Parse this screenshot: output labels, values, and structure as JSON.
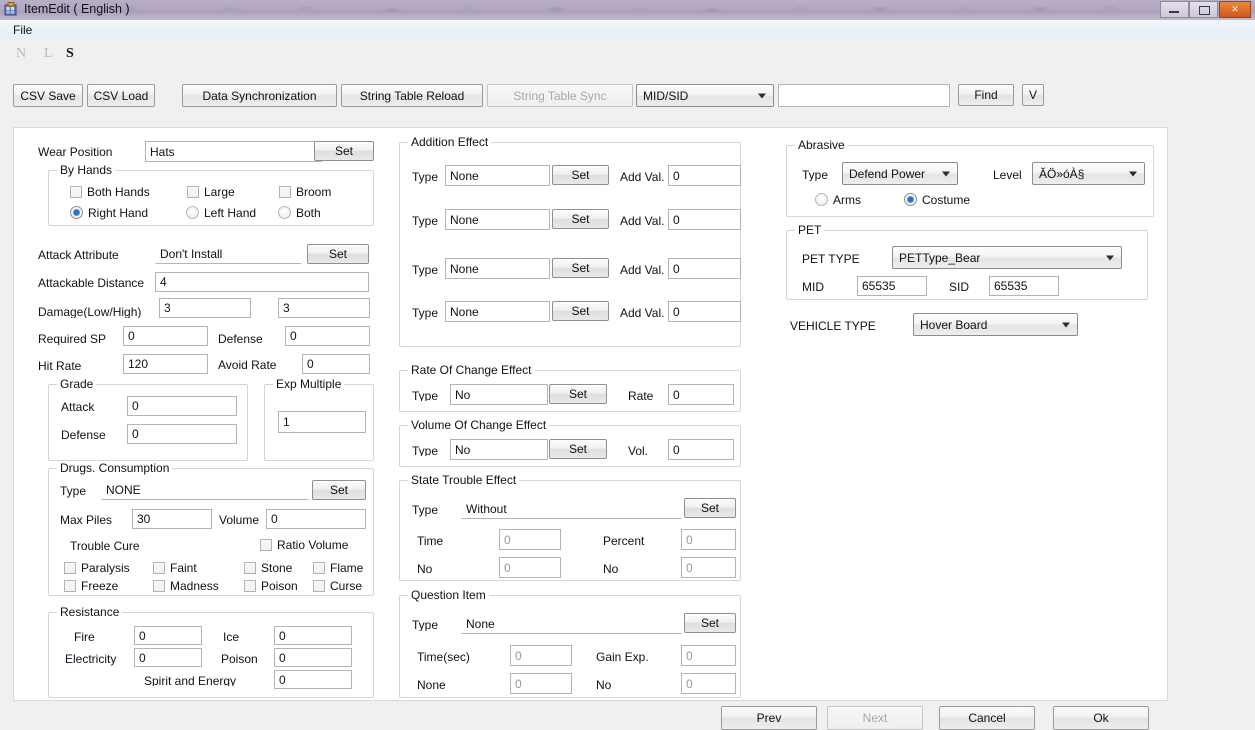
{
  "window": {
    "title": "ItemEdit ( English )",
    "minimize_label": "minimize",
    "maximize_label": "maximize",
    "close_label": "✕"
  },
  "menu": {
    "file": "File"
  },
  "indicators": {
    "n": "N",
    "l": "L",
    "s": "S"
  },
  "toolbar": {
    "csv_save": "CSV Save",
    "csv_load": "CSV Load",
    "data_sync": "Data Synchronization",
    "string_table_reload": "String Table Reload",
    "string_table_sync": "String Table Sync",
    "mid_sid_selected": "MID/SID",
    "search_value": "",
    "find": "Find",
    "v": "V"
  },
  "left": {
    "wear_position_label": "Wear Position",
    "wear_position_value": "Hats",
    "wear_position_set": "Set",
    "by_hands": {
      "legend": "By Hands",
      "checkboxes": [
        {
          "label": "Both Hands",
          "checked": false
        },
        {
          "label": "Large",
          "checked": false
        },
        {
          "label": "Broom",
          "checked": false
        }
      ],
      "radios": [
        {
          "label": "Right Hand",
          "selected": true
        },
        {
          "label": "Left Hand",
          "selected": false
        },
        {
          "label": "Both",
          "selected": false
        }
      ]
    },
    "attack_attribute_label": "Attack Attribute",
    "attack_attribute_value": "Don't Install",
    "attack_attribute_set": "Set",
    "attackable_distance_label": "Attackable Distance",
    "attackable_distance_value": "4",
    "damage_label": "Damage(Low/High)",
    "damage_low": "3",
    "damage_high": "3",
    "required_sp_label": "Required SP",
    "required_sp_value": "0",
    "defense_label": "Defense",
    "defense_value": "0",
    "hit_rate_label": "Hit Rate",
    "hit_rate_value": "120",
    "avoid_rate_label": "Avoid Rate",
    "avoid_rate_value": "0",
    "grade": {
      "legend": "Grade",
      "attack_label": "Attack",
      "attack_value": "0",
      "defense_label": "Defense",
      "defense_value": "0"
    },
    "exp_multiple": {
      "legend": "Exp Multiple",
      "value": "1"
    },
    "drugs": {
      "legend": "Drugs. Consumption",
      "type_label": "Type",
      "type_value": "NONE",
      "type_set": "Set",
      "max_piles_label": "Max Piles",
      "max_piles_value": "30",
      "volume_label": "Volume",
      "volume_value": "0",
      "ratio_volume_label": "Ratio Volume",
      "ratio_volume_checked": false,
      "trouble_cure_label": "Trouble Cure",
      "cures": [
        {
          "label": "Paralysis",
          "checked": false
        },
        {
          "label": "Faint",
          "checked": false
        },
        {
          "label": "Stone",
          "checked": false
        },
        {
          "label": "Flame",
          "checked": false
        },
        {
          "label": "Freeze",
          "checked": false
        },
        {
          "label": "Madness",
          "checked": false
        },
        {
          "label": "Poison",
          "checked": false
        },
        {
          "label": "Curse",
          "checked": false
        }
      ]
    },
    "resistance": {
      "legend": "Resistance",
      "fire_label": "Fire",
      "fire_value": "0",
      "ice_label": "Ice",
      "ice_value": "0",
      "electricity_label": "Electricity",
      "electricity_value": "0",
      "poison_label": "Poison",
      "poison_value": "0",
      "spirit_label": "Spirit and Energy",
      "spirit_value": "0"
    }
  },
  "middle": {
    "addition_effect": {
      "legend": "Addition Effect",
      "type_label": "Type",
      "set_label": "Set",
      "addval_label": "Add Val.",
      "rows": [
        {
          "type": "None",
          "add_val": "0"
        },
        {
          "type": "None",
          "add_val": "0"
        },
        {
          "type": "None",
          "add_val": "0"
        },
        {
          "type": "None",
          "add_val": "0"
        }
      ]
    },
    "rate_of_change": {
      "legend": "Rate Of Change Effect",
      "type_label": "Type",
      "type_value": "No",
      "set_label": "Set",
      "rate_label": "Rate",
      "rate_value": "0"
    },
    "volume_of_change": {
      "legend": "Volume Of Change Effect",
      "type_label": "Type",
      "type_value": "No",
      "set_label": "Set",
      "vol_label": "Vol.",
      "vol_value": "0"
    },
    "state_trouble": {
      "legend": "State Trouble Effect",
      "type_label": "Type",
      "type_value": "Without",
      "set_label": "Set",
      "time_label": "Time",
      "time_value": "0",
      "percent_label": "Percent",
      "percent_value": "0",
      "no1_label": "No",
      "no1_value": "0",
      "no2_label": "No",
      "no2_value": "0"
    },
    "question_item": {
      "legend": "Question Item",
      "type_label": "Type",
      "type_value": "None",
      "set_label": "Set",
      "time_label": "Time(sec)",
      "time_value": "0",
      "gain_exp_label": "Gain Exp.",
      "gain_exp_value": "0",
      "none_label": "None",
      "none_value": "0",
      "no_label": "No",
      "no_value": "0"
    }
  },
  "right": {
    "abrasive": {
      "legend": "Abrasive",
      "type_label": "Type",
      "type_value": "Defend Power",
      "level_label": "Level",
      "level_value": "ĂÖ»óÀ§",
      "radios": [
        {
          "label": "Arms",
          "selected": false
        },
        {
          "label": "Costume",
          "selected": true
        }
      ]
    },
    "pet": {
      "legend": "PET",
      "pet_type_label": "PET TYPE",
      "pet_type_value": "PETType_Bear",
      "mid_label": "MID",
      "mid_value": "65535",
      "sid_label": "SID",
      "sid_value": "65535"
    },
    "vehicle_type_label": "VEHICLE TYPE",
    "vehicle_type_value": "Hover Board"
  },
  "footer": {
    "prev": "Prev",
    "next": "Next",
    "cancel": "Cancel",
    "ok": "Ok"
  }
}
